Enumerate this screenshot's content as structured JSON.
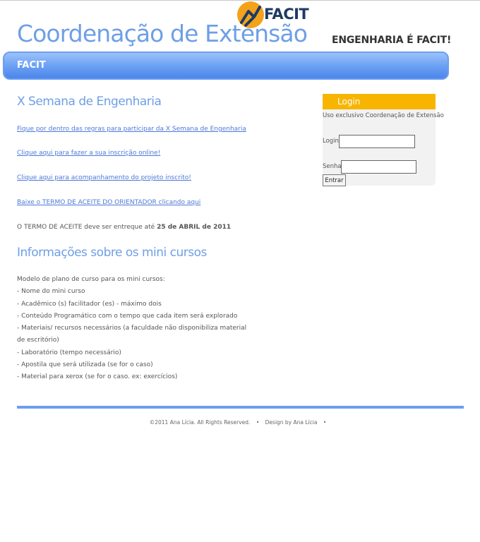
{
  "header": {
    "logo_text": "FACIT",
    "site_title": "Coordenação de Extensão",
    "slogan": "ENGENHARIA É FACIT!"
  },
  "nav": {
    "items": [
      {
        "label": "FACIT"
      }
    ]
  },
  "main": {
    "section1_title": "X Semana de Engenharia",
    "links": [
      "Fique por dentro das regras para participar da X Semana de Engenharia",
      "Clique aqui para fazer a sua inscrição online!",
      "Clique aqui para acompanhamento do projeto inscrito!",
      "Baixe o TERMO DE ACEITE DO ORIENTADOR clicando aqui"
    ],
    "deadline_note_prefix": "O TERMO DE ACEITE deve ser entreque até ",
    "deadline_date": "25 de ABRIL de 2011",
    "section2_title": "Informações sobre os mini cursos",
    "course_lines": [
      "Modelo de plano de curso para os mini cursos:",
      "- Nome do mini curso",
      "- Acadêmico (s) facilitador (es) - máximo dois",
      "- Conteúdo Programático com o tempo que cada item será explorado",
      "- Materiais/ recursos necessários (a faculdade não disponibiliza material",
      "de escritório)",
      "- Laboratório (tempo necessário)",
      "- Apostila que será utilizada (se for o caso)",
      "- Material para xerox (se for o caso. ex: exercícios)"
    ]
  },
  "login": {
    "title": "Login",
    "description": "Uso exclusivo Coordenação de Extensão",
    "login_label": "Login",
    "login_value": "",
    "password_label": "Senha",
    "password_value": "",
    "submit_label": "Entrar"
  },
  "footer": {
    "copyright": "©2011 Ana Lícia. All Rights Reserved.",
    "separator": "•",
    "design_credit": "Design by Ana Lícia"
  },
  "colors": {
    "accent_blue": "#6e9fe6",
    "nav_blue": "#6ca1f4",
    "login_header": "#f7b500",
    "logo_orange": "#f2a31b",
    "logo_navy": "#1f3a63"
  }
}
